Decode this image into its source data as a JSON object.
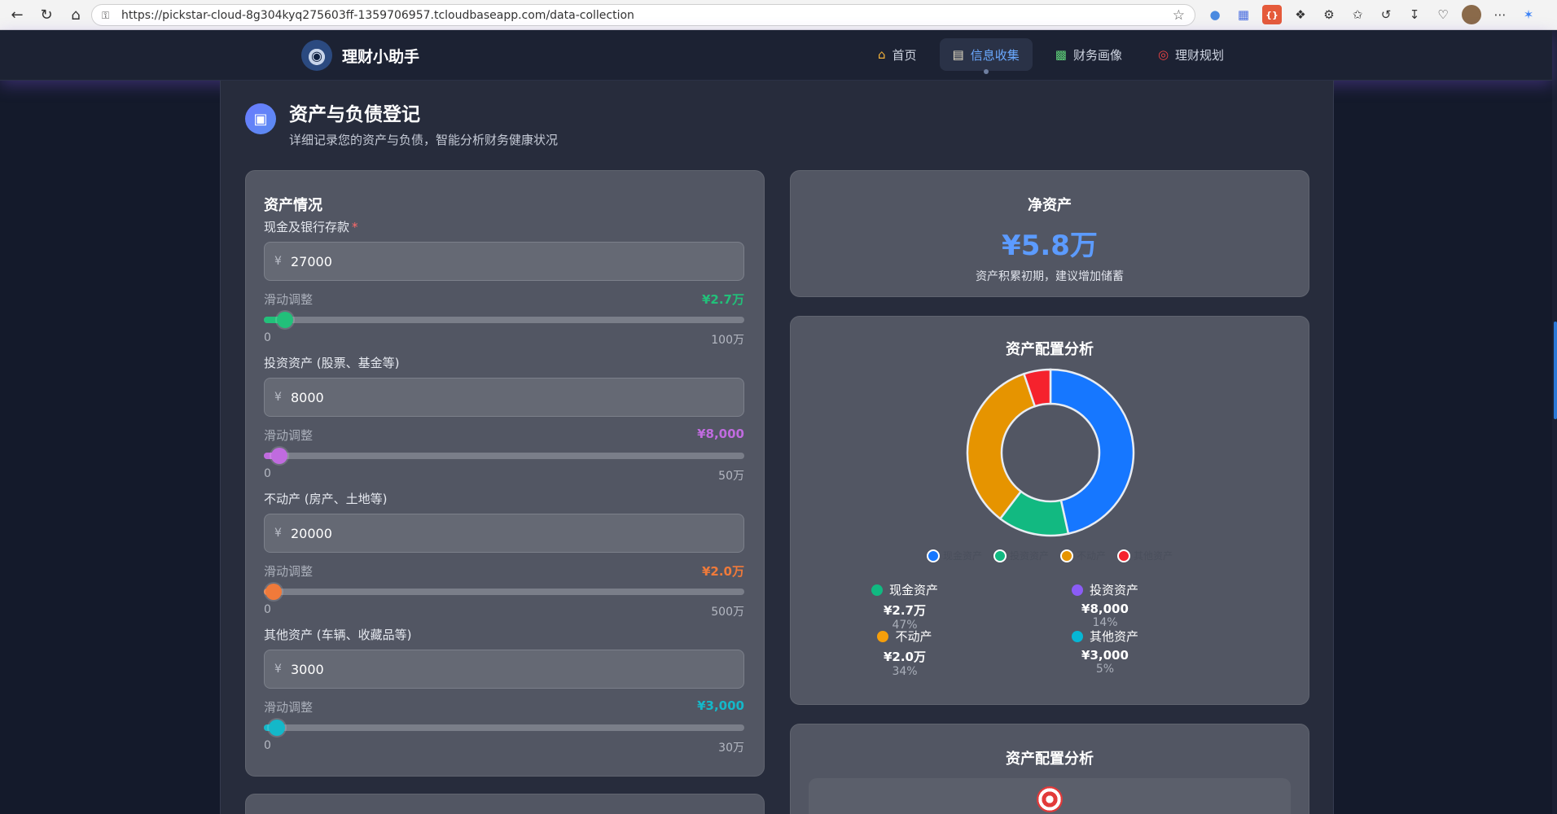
{
  "browser": {
    "url": "https://pickstar-cloud-8g304kyq275603ff-1359706957.tcloudbaseapp.com/data-collection"
  },
  "header": {
    "brand_name": "理财小助手",
    "nav": [
      {
        "label": "首页",
        "icon": "home-icon"
      },
      {
        "label": "信息收集",
        "icon": "clipboard-icon",
        "active": true
      },
      {
        "label": "财务画像",
        "icon": "bar-chart-icon"
      },
      {
        "label": "理财规划",
        "icon": "target-icon"
      }
    ]
  },
  "page": {
    "title": "资产与负债登记",
    "subtitle": "详细记录您的资产与负债，智能分析财务健康状况"
  },
  "assets": {
    "title": "资产情况",
    "slider_label": "滑动调整",
    "fields": [
      {
        "label": "现金及银行存款",
        "required": true,
        "currency": "¥",
        "value": "27000",
        "display": "¥2.7万",
        "min": "0",
        "max": "100万",
        "fraction": 0.027,
        "color": "#22c07a"
      },
      {
        "label": "投资资产 (股票、基金等)",
        "required": false,
        "currency": "¥",
        "value": "8000",
        "display": "¥8,000",
        "min": "0",
        "max": "50万",
        "fraction": 0.016,
        "color": "#c06bdf"
      },
      {
        "label": "不动产 (房产、土地等)",
        "required": false,
        "currency": "¥",
        "value": "20000",
        "display": "¥2.0万",
        "min": "0",
        "max": "500万",
        "fraction": 0.004,
        "color": "#f07a3a"
      },
      {
        "label": "其他资产 (车辆、收藏品等)",
        "required": false,
        "currency": "¥",
        "value": "3000",
        "display": "¥3,000",
        "min": "0",
        "max": "30万",
        "fraction": 0.01,
        "color": "#14b8c9"
      }
    ]
  },
  "net_worth": {
    "title": "净资产",
    "value": "¥5.8万",
    "hint": "资产积累初期，建议增加储蓄"
  },
  "allocation": {
    "title": "资产配置分析",
    "breakdown": [
      {
        "name": "现金资产",
        "amount": "¥2.7万",
        "pct": "47%",
        "dot": "#10b981"
      },
      {
        "name": "投资资产",
        "amount": "¥8,000",
        "pct": "14%",
        "dot": "#8b5cf6"
      },
      {
        "name": "不动产",
        "amount": "¥2.0万",
        "pct": "34%",
        "dot": "#f59e0b"
      },
      {
        "name": "其他资产",
        "amount": "¥3,000",
        "pct": "5%",
        "dot": "#06b6d4"
      }
    ]
  },
  "chart_data": {
    "type": "pie",
    "categories": [
      "现金资产",
      "投资资产",
      "不动产",
      "其他资产"
    ],
    "values": [
      27000,
      8000,
      20000,
      3000
    ],
    "colors": [
      "#1677ff",
      "#12b981",
      "#e69400",
      "#f5222d"
    ],
    "legend_position": "bottom",
    "title": ""
  },
  "allocation2": {
    "title": "资产配置分析"
  },
  "colors": {
    "accent": "#5c9bff",
    "background": "#141a2b"
  }
}
